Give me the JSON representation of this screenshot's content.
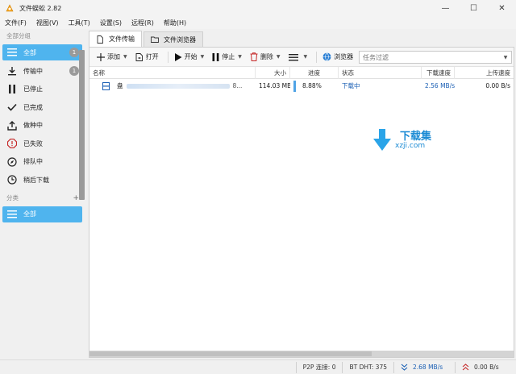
{
  "window": {
    "title": "文件蜈蚣 2.82",
    "controls": {
      "minimize": "—",
      "maximize": "☐",
      "close": "✕"
    }
  },
  "menu": [
    "文件(F)",
    "视图(V)",
    "工具(T)",
    "设置(S)",
    "远程(R)",
    "帮助(H)"
  ],
  "sidebar": {
    "group_header": "全部分组",
    "items": [
      {
        "label": "全部",
        "icon": "list-icon",
        "badge": "1",
        "active": true
      },
      {
        "label": "传输中",
        "icon": "download-icon",
        "badge": "1"
      },
      {
        "label": "已停止",
        "icon": "pause-icon"
      },
      {
        "label": "已完成",
        "icon": "check-icon"
      },
      {
        "label": "做种中",
        "icon": "upload-icon"
      },
      {
        "label": "已失败",
        "icon": "error-icon"
      },
      {
        "label": "排队中",
        "icon": "compass-icon"
      },
      {
        "label": "稍后下载",
        "icon": "clock-icon"
      }
    ],
    "category_header": "分类",
    "add_category": "+",
    "category_items": [
      {
        "label": "全部",
        "icon": "list-icon",
        "active": true
      }
    ]
  },
  "tabs": [
    {
      "label": "文件传输",
      "icon": "file-icon",
      "active": true
    },
    {
      "label": "文件浏览器",
      "icon": "folder-icon",
      "active": false
    }
  ],
  "toolbar": {
    "add": "添加",
    "open": "打开",
    "start": "开始",
    "stop": "停止",
    "delete": "删除",
    "browser": "浏览器",
    "filter_placeholder": "任务过滤"
  },
  "table": {
    "columns": [
      "名称",
      "大小",
      "进度",
      "状态",
      "下载速度",
      "上传速度"
    ],
    "rows": [
      {
        "name": "盘",
        "name_tail": "8...",
        "size": "114.03 MB",
        "progress": "8.88%",
        "status": "下载中",
        "down_speed": "2.56 MB/s",
        "up_speed": "0.00 B/s"
      }
    ]
  },
  "watermark": {
    "text_main": "下载集",
    "text_sub": "xzji.com"
  },
  "statusbar": {
    "p2p_label": "P2P 连接:",
    "p2p_value": "0",
    "dht_label": "BT DHT:",
    "dht_value": "375",
    "down_speed": "2.68 MB/s",
    "up_speed": "0.00 B/s"
  },
  "colors": {
    "accent": "#4fb4ee",
    "speed_blue": "#1a5fb4"
  }
}
